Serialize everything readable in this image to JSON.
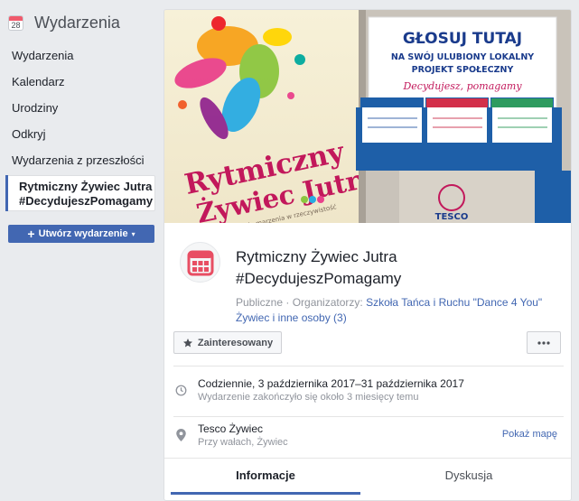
{
  "sidebar": {
    "header_icon_day": "28",
    "title": "Wydarzenia",
    "items": [
      {
        "label": "Wydarzenia"
      },
      {
        "label": "Kalendarz"
      },
      {
        "label": "Urodziny"
      },
      {
        "label": "Odkryj"
      },
      {
        "label": "Wydarzenia z przeszłości"
      }
    ],
    "active_item": {
      "line1": "Rytmiczny Żywiec Jutra",
      "line2": "#DecydujeszPomagamy"
    },
    "create_button": {
      "icon": "plus-icon",
      "label": "Utwórz wydarzenie",
      "caret": "▾"
    }
  },
  "cover": {
    "poster_title_1": "Rytmiczny",
    "poster_title_2": "Żywiec Jutra",
    "poster_subtitle": "zmienia marzenia w rzeczywistość",
    "sign_line1": "GŁOSUJ TUTAJ",
    "sign_line2": "NA SWÓJ ULUBIONY LOKALNY",
    "sign_line3": "PROJEKT SPOŁECZNY",
    "sign_slogan": "Decydujesz, pomagamy",
    "brand": "TESCO"
  },
  "event": {
    "icon": "calendar-icon",
    "title_line1": "Rytmiczny Żywiec Jutra",
    "title_line2": "#DecydujeszPomagamy",
    "privacy": "Publiczne",
    "separator": " · ",
    "organizers_label": "Organizatorzy: ",
    "organizers": "Szkoła Tańca i Ruchu \"Dance 4 You\" Żywiec i inne osoby (3)"
  },
  "actions": {
    "interested_label": "Zainteresowany",
    "interested_icon": "star-icon",
    "more_label": "···"
  },
  "details": {
    "date_icon": "clock-icon",
    "date_main": "Codziennie, 3 października 2017–31 października 2017",
    "date_sub": "Wydarzenie zakończyło się około 3 miesięcy temu",
    "place_icon": "map-pin-icon",
    "place_name": "Tesco Żywiec",
    "place_address": "Przy wałach, Żywiec",
    "map_link": "Pokaż mapę"
  },
  "tabs": [
    {
      "label": "Informacje",
      "active": true
    },
    {
      "label": "Dyskusja",
      "active": false
    }
  ],
  "colors": {
    "accent": "#4267b2",
    "page_bg": "#e9ebee",
    "event_icon": "#e84e63"
  }
}
